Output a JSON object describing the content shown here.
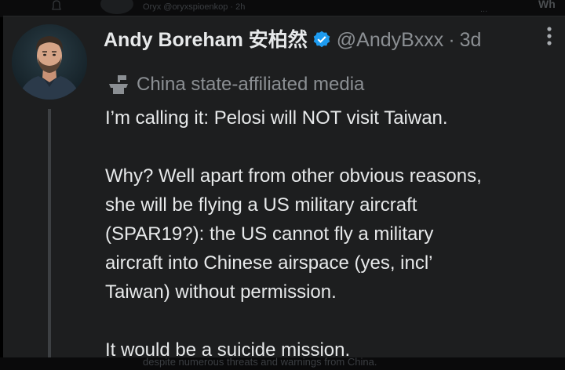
{
  "background_tweet": {
    "top_text": "Oryx @oryxspioenkop · 2h",
    "top_right_mark": "...",
    "top_right_text": "Wh",
    "bottom_text": "despite numerous threats and warnings from China."
  },
  "tweet": {
    "display_name": "Andy Boreham 安柏然",
    "handle": "@AndyBxxx",
    "separator": "·",
    "timestamp": "3d",
    "affiliation_label": "China state-affiliated media",
    "body_lines": [
      "I’m calling it: Pelosi will NOT visit Taiwan.",
      "",
      "Why? Well apart from other obvious reasons,",
      "she will be flying a US military aircraft",
      "(SPAR19?): the US cannot fly a military",
      "aircraft into Chinese airspace (yes, incl’",
      "Taiwan) without permission.",
      "",
      "It would be a suicide mission."
    ]
  },
  "icons": {
    "verified": "verified-badge-icon",
    "affiliation": "podium-icon",
    "more": "more-vertical-icon",
    "notification": "bell-icon"
  },
  "colors": {
    "card_background": "#1d1e1f",
    "primary_text": "#e7e9ea",
    "secondary_text": "#8b8f93",
    "verified_blue": "#1d9bf0",
    "thread_line": "#3d4043"
  }
}
